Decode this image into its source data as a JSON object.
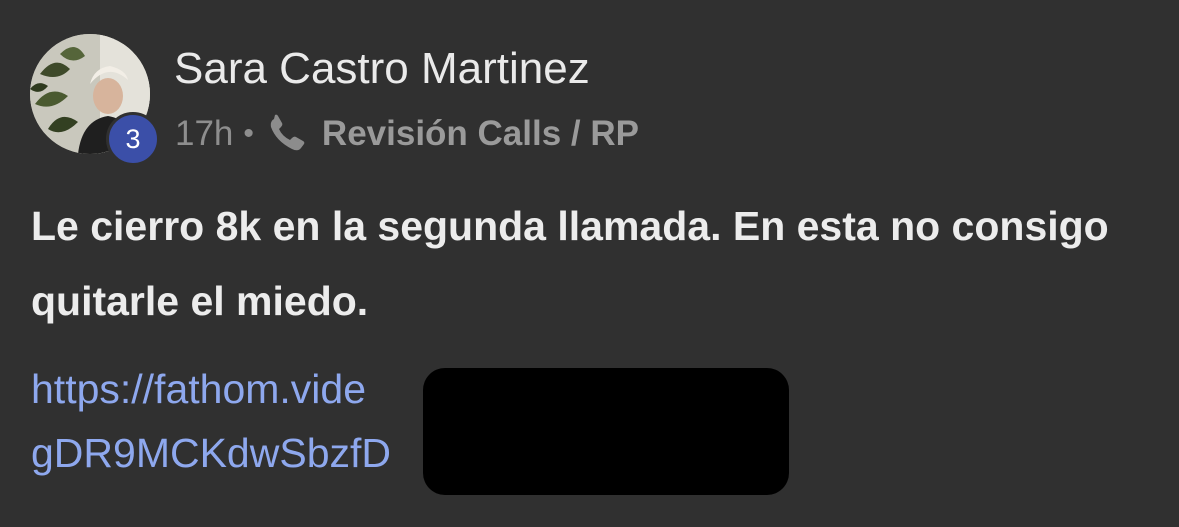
{
  "post": {
    "author": "Sara Castro Martinez",
    "level_badge": "3",
    "time": "17h",
    "separator": "•",
    "channel_icon": "phone-icon",
    "channel": "Revisión Calls / RP",
    "body": "Le cierro 8k en la segunda llamada. En esta no consigo quitarle el miedo.",
    "link_line_1": "https://fathom.vide",
    "link_line_2": "gDR9MCKdwSbzfD"
  },
  "colors": {
    "background": "#303030",
    "text": "#ececec",
    "muted": "#8e8e8e",
    "link": "#8ea8ee",
    "badge": "#3b4fa8",
    "redaction": "#000000"
  }
}
